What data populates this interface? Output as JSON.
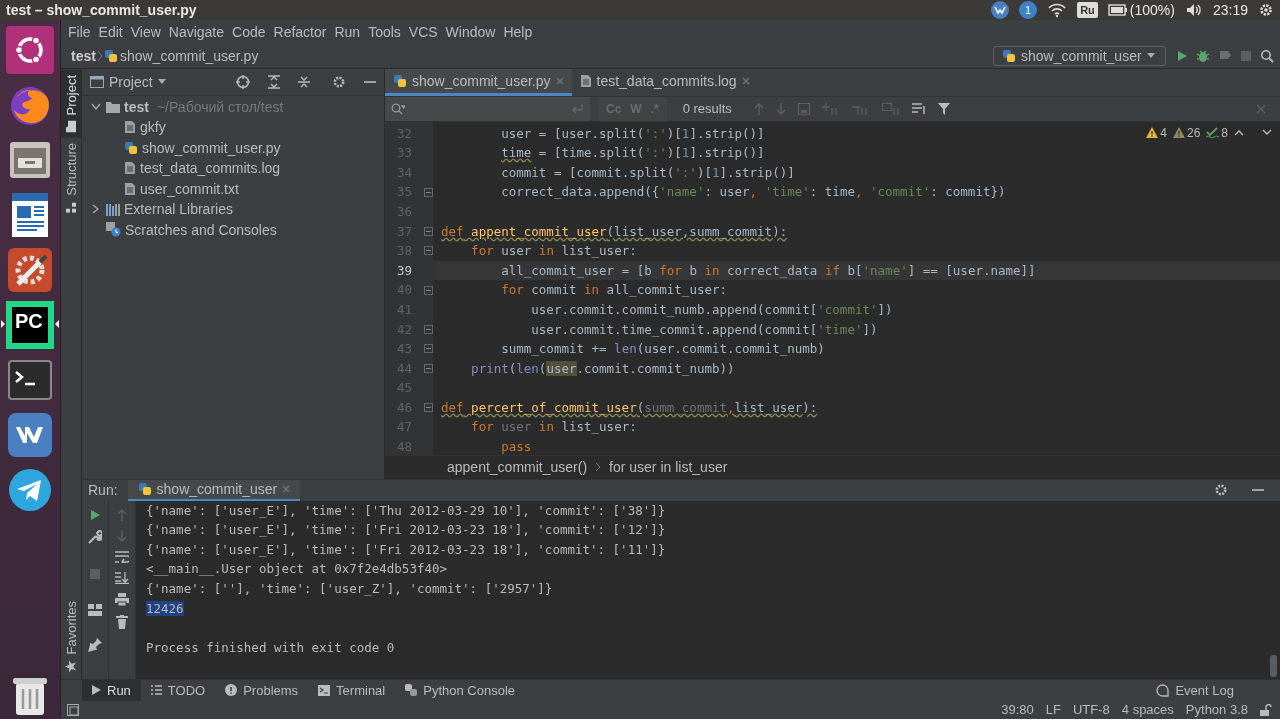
{
  "system_bar": {
    "title": "test – show_commit_user.py",
    "notification_count": "1",
    "keyboard_layout": "Ru",
    "battery": "(100%)",
    "clock": "23:19"
  },
  "launcher": [
    {
      "kind": "logo",
      "focused": false
    },
    {
      "kind": "browser",
      "focused": false
    },
    {
      "kind": "files",
      "focused": false
    },
    {
      "kind": "writer",
      "focused": false
    },
    {
      "kind": "settings",
      "focused": false
    },
    {
      "kind": "ide",
      "label": "PC",
      "focused": true
    },
    {
      "kind": "terminal",
      "focused": false
    },
    {
      "kind": "messenger",
      "focused": false
    },
    {
      "kind": "telegram",
      "focused": false
    },
    {
      "kind": "trash",
      "focused": false
    }
  ],
  "menu": [
    "File",
    "Edit",
    "View",
    "Navigate",
    "Code",
    "Refactor",
    "Run",
    "Tools",
    "VCS",
    "Window",
    "Help"
  ],
  "navigation": {
    "breadcrumbs": [
      "test",
      "show_commit_user.py"
    ],
    "run_configuration": "show_commit_user"
  },
  "tool_strip": [
    {
      "label": "Project",
      "kind": "project",
      "selected": true
    },
    {
      "label": "Structure",
      "kind": "structure",
      "selected": false
    },
    {
      "label": "Favorites",
      "kind": "favorites",
      "selected": false
    }
  ],
  "project": {
    "title": "Project",
    "tree": [
      {
        "label": "test",
        "hint": "~/Рабочий стол/test",
        "kind": "folder",
        "expanded": true,
        "children": [
          {
            "label": "gkfy",
            "kind": "text"
          },
          {
            "label": "show_commit_user.py",
            "kind": "python"
          },
          {
            "label": "test_data_commits.log",
            "kind": "text"
          },
          {
            "label": "user_commit.txt",
            "kind": "text"
          }
        ]
      },
      {
        "label": "External Libraries",
        "kind": "library",
        "expanded": false
      },
      {
        "label": "Scratches and Consoles",
        "kind": "scratches"
      }
    ]
  },
  "editor": {
    "tabs": [
      {
        "label": "show_commit_user.py",
        "kind": "python",
        "selected": true
      },
      {
        "label": "test_data_commits.log",
        "kind": "text",
        "selected": false
      }
    ],
    "find": {
      "match_case": "Cc",
      "words": "W",
      "regex": ".*",
      "result": "0 results"
    },
    "inspections": [
      {
        "kind": "warning",
        "count": "4"
      },
      {
        "kind": "weak_warning",
        "count": "26"
      },
      {
        "kind": "typo",
        "count": "8"
      }
    ],
    "lines": [
      {
        "number": "32",
        "current": false,
        "fold": false,
        "warning": false,
        "tokens": [
          {
            "kind": "plain",
            "text": "        user = [user.split("
          },
          {
            "kind": "string",
            "text": "':'"
          },
          {
            "kind": "plain",
            "text": ")["
          },
          {
            "kind": "number",
            "text": "1"
          },
          {
            "kind": "plain",
            "text": "].strip()]"
          }
        ]
      },
      {
        "number": "33",
        "current": false,
        "fold": false,
        "warning": false,
        "tokens": [
          {
            "kind": "warned",
            "text": "        time"
          },
          {
            "kind": "plain",
            "text": " = [time.split("
          },
          {
            "kind": "string",
            "text": "':'"
          },
          {
            "kind": "plain",
            "text": ")["
          },
          {
            "kind": "number",
            "text": "1"
          },
          {
            "kind": "plain",
            "text": "].strip()]"
          }
        ]
      },
      {
        "number": "34",
        "current": false,
        "fold": false,
        "warning": false,
        "tokens": [
          {
            "kind": "plain",
            "text": "        commit = [commit.split("
          },
          {
            "kind": "string",
            "text": "':'"
          },
          {
            "kind": "plain",
            "text": ")["
          },
          {
            "kind": "number",
            "text": "1"
          },
          {
            "kind": "plain",
            "text": "].strip()]"
          }
        ]
      },
      {
        "number": "35",
        "current": false,
        "fold": true,
        "warning": false,
        "tokens": [
          {
            "kind": "plain",
            "text": "        correct_data.append({"
          },
          {
            "kind": "string",
            "text": "'name'"
          },
          {
            "kind": "plain",
            "text": ": user"
          },
          {
            "kind": "keyword",
            "text": ","
          },
          {
            "kind": "string",
            "text": " 'time'"
          },
          {
            "kind": "plain",
            "text": ": time"
          },
          {
            "kind": "keyword",
            "text": ","
          },
          {
            "kind": "string",
            "text": " 'commit'"
          },
          {
            "kind": "plain",
            "text": ": commit})"
          }
        ]
      },
      {
        "number": "36",
        "current": false,
        "fold": false
      },
      {
        "number": "37",
        "current": false,
        "fold": true,
        "warning": true,
        "tokens": [
          {
            "kind": "keyword",
            "text": "def"
          },
          {
            "kind": "function",
            "text": " appent_commit_user"
          },
          {
            "kind": "plain",
            "text": "(list_user,summ_commit):"
          }
        ]
      },
      {
        "number": "38",
        "current": false,
        "fold": true,
        "warning": false,
        "tokens": [
          {
            "kind": "keyword",
            "text": "    for"
          },
          {
            "kind": "plain",
            "text": " user "
          },
          {
            "kind": "keyword",
            "text": "in"
          },
          {
            "kind": "plain",
            "text": " list_user:"
          }
        ]
      },
      {
        "number": "39",
        "current": true,
        "fold": false,
        "warning": false,
        "tokens": [
          {
            "kind": "plain",
            "text": "        all_commit_user = [b "
          },
          {
            "kind": "keyword",
            "text": "for"
          },
          {
            "kind": "plain",
            "text": " b "
          },
          {
            "kind": "keyword",
            "text": "in"
          },
          {
            "kind": "plain",
            "text": " correct_data "
          },
          {
            "kind": "keyword",
            "text": "if"
          },
          {
            "kind": "plain",
            "text": " b["
          },
          {
            "kind": "string",
            "text": "'name'"
          },
          {
            "kind": "plain",
            "text": "] == [user.name]]"
          }
        ]
      },
      {
        "number": "40",
        "current": false,
        "fold": true,
        "warning": false,
        "tokens": [
          {
            "kind": "keyword",
            "text": "        for"
          },
          {
            "kind": "plain",
            "text": " commit "
          },
          {
            "kind": "keyword",
            "text": "in"
          },
          {
            "kind": "plain",
            "text": " all_commit_user:"
          }
        ]
      },
      {
        "number": "41",
        "current": false,
        "fold": false,
        "warning": false,
        "tokens": [
          {
            "kind": "plain",
            "text": "            user.commit.commit_numb.append(commit["
          },
          {
            "kind": "string",
            "text": "'commit'"
          },
          {
            "kind": "plain",
            "text": "])"
          }
        ]
      },
      {
        "number": "42",
        "current": false,
        "fold": true,
        "warning": false,
        "tokens": [
          {
            "kind": "plain",
            "text": "            user.commit.time_commit.append(commit["
          },
          {
            "kind": "string",
            "text": "'time'"
          },
          {
            "kind": "plain",
            "text": "])"
          }
        ]
      },
      {
        "number": "43",
        "current": false,
        "fold": true,
        "warning": false,
        "tokens": [
          {
            "kind": "plain",
            "text": "        summ_commit += "
          },
          {
            "kind": "builtin",
            "text": "len"
          },
          {
            "kind": "plain",
            "text": "(user.commit.commit_numb)"
          }
        ]
      },
      {
        "number": "44",
        "current": false,
        "fold": true,
        "warning": false,
        "tokens": [
          {
            "kind": "builtin",
            "text": "    print"
          },
          {
            "kind": "plain",
            "text": "("
          },
          {
            "kind": "builtin",
            "text": "len"
          },
          {
            "kind": "plain",
            "text": "("
          },
          {
            "kind": "usage",
            "text": "user"
          },
          {
            "kind": "plain",
            "text": ".commit.commit_numb))"
          }
        ]
      },
      {
        "number": "45",
        "current": false,
        "fold": false
      },
      {
        "number": "46",
        "current": false,
        "fold": true,
        "warning": true,
        "tokens": [
          {
            "kind": "keyword",
            "text": "def"
          },
          {
            "kind": "function",
            "text": " percert_of_commit_user"
          },
          {
            "kind": "plain",
            "text": "("
          },
          {
            "kind": "unused",
            "text": "summ_commit"
          },
          {
            "kind": "keyword",
            "text": ","
          },
          {
            "kind": "plain",
            "text": "list_user):"
          }
        ]
      },
      {
        "number": "47",
        "current": false,
        "fold": false,
        "warning": false,
        "tokens": [
          {
            "kind": "keyword",
            "text": "    for"
          },
          {
            "kind": "unused",
            "text": " user"
          },
          {
            "kind": "keyword",
            "text": " in"
          },
          {
            "kind": "plain",
            "text": " list_user:"
          }
        ]
      },
      {
        "number": "48",
        "current": false,
        "fold": false,
        "warning": false,
        "tokens": [
          {
            "kind": "keyword",
            "text": "        pass"
          }
        ]
      }
    ],
    "breadcrumbs": [
      "appent_commit_user()",
      "for user in list_user"
    ]
  },
  "run": {
    "title": "Run:",
    "tab": "show_commit_user",
    "output": [
      {
        "text": "{'name': ['user_E'], 'time': ['Thu 2012-03-29 10'], 'commit': ['38']}",
        "selected": false
      },
      {
        "text": "{'name': ['user_E'], 'time': ['Fri 2012-03-23 18'], 'commit': ['12']}",
        "selected": false
      },
      {
        "text": "{'name': ['user_E'], 'time': ['Fri 2012-03-23 18'], 'commit': ['11']}",
        "selected": false
      },
      {
        "text": "<__main__.User object at 0x7f2e4db53f40>",
        "selected": false
      },
      {
        "text": "{'name': [''], 'time': ['user_Z'], 'commit': ['2957']}",
        "selected": false
      },
      {
        "text": "12426",
        "selected": true
      },
      {
        "text": "Process finished with exit code 0",
        "selected": false
      }
    ]
  },
  "bottom_tabs": [
    {
      "label": "Run",
      "kind": "run",
      "selected": true
    },
    {
      "label": "TODO",
      "kind": "todo",
      "selected": false
    },
    {
      "label": "Problems",
      "kind": "problems",
      "selected": false
    },
    {
      "label": "Terminal",
      "kind": "terminal",
      "selected": false
    },
    {
      "label": "Python Console",
      "kind": "console",
      "selected": false
    }
  ],
  "event_log": "Event Log",
  "status": [
    "39:80",
    "LF",
    "UTF-8",
    "4 spaces",
    "Python 3.8"
  ]
}
